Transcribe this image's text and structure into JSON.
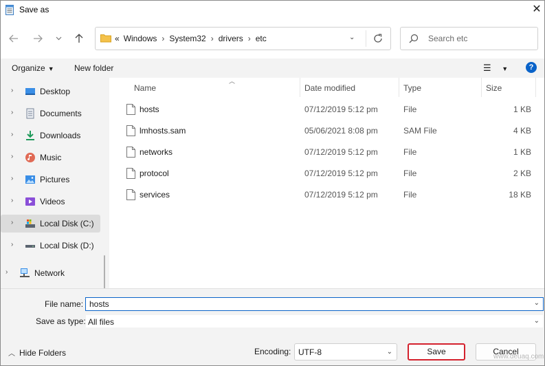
{
  "window": {
    "title": "Save as"
  },
  "address": {
    "prefix": "«",
    "crumbs": [
      "Windows",
      "System32",
      "drivers",
      "etc"
    ]
  },
  "search": {
    "placeholder": "Search etc"
  },
  "toolbar": {
    "organize": "Organize",
    "new_folder": "New folder"
  },
  "nav": {
    "items": [
      {
        "label": "Desktop",
        "icon": "desktop-icon"
      },
      {
        "label": "Documents",
        "icon": "documents-icon"
      },
      {
        "label": "Downloads",
        "icon": "downloads-icon"
      },
      {
        "label": "Music",
        "icon": "music-icon"
      },
      {
        "label": "Pictures",
        "icon": "pictures-icon"
      },
      {
        "label": "Videos",
        "icon": "videos-icon"
      },
      {
        "label": "Local Disk (C:)",
        "icon": "drive-c-icon",
        "selected": true
      },
      {
        "label": "Local Disk (D:)",
        "icon": "drive-d-icon"
      },
      {
        "label": "Network",
        "icon": "network-icon"
      }
    ]
  },
  "columns": {
    "name": "Name",
    "date": "Date modified",
    "type": "Type",
    "size": "Size"
  },
  "files": [
    {
      "name": "hosts",
      "date": "07/12/2019 5:12 pm",
      "type": "File",
      "size": "1 KB"
    },
    {
      "name": "lmhosts.sam",
      "date": "05/06/2021 8:08 pm",
      "type": "SAM File",
      "size": "4 KB"
    },
    {
      "name": "networks",
      "date": "07/12/2019 5:12 pm",
      "type": "File",
      "size": "1 KB"
    },
    {
      "name": "protocol",
      "date": "07/12/2019 5:12 pm",
      "type": "File",
      "size": "2 KB"
    },
    {
      "name": "services",
      "date": "07/12/2019 5:12 pm",
      "type": "File",
      "size": "18 KB"
    }
  ],
  "form": {
    "file_name_label": "File name:",
    "file_name_value": "hosts",
    "save_type_label": "Save as type:",
    "save_type_value": "All files"
  },
  "footer": {
    "hide_folders": "Hide Folders",
    "encoding_label": "Encoding:",
    "encoding_value": "UTF-8",
    "save": "Save",
    "cancel": "Cancel",
    "watermark": "www.deuaq.com"
  },
  "colors": {
    "accent": "#0a63c9",
    "highlight_border": "#d4202c",
    "pane_bg": "#f3f3f3"
  }
}
